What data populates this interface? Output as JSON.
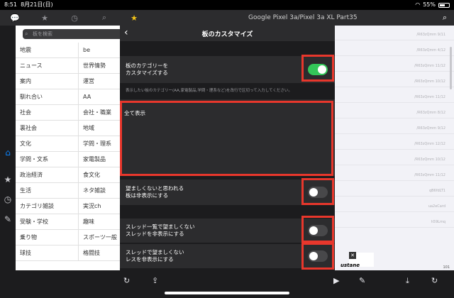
{
  "statusbar": {
    "time": "8:51",
    "date": "8月21日(日)",
    "battery": "55%"
  },
  "tabs": [
    "💬",
    "★",
    "◷",
    "⌕",
    "★"
  ],
  "thread": {
    "title": "Google Pixel 3a/Pixel 3a XL Part35",
    "search_icon": "⌕"
  },
  "search": {
    "placeholder": "板を検索"
  },
  "categories": [
    [
      "地震",
      "be"
    ],
    [
      "ニュース",
      "世界情勢"
    ],
    [
      "案内",
      "運営"
    ],
    [
      "馴れ合い",
      "AA"
    ],
    [
      "社会",
      "会社・職業"
    ],
    [
      "裏社会",
      "地域"
    ],
    [
      "文化",
      "学問・理系"
    ],
    [
      "学問・文系",
      "家電製品"
    ],
    [
      "政治経済",
      "食文化"
    ],
    [
      "生活",
      "ネタ雑談"
    ],
    [
      "カテゴリ雑談",
      "実況ch"
    ],
    [
      "受験・学校",
      "趣味"
    ],
    [
      "乗り物",
      "スポーツ一般"
    ],
    [
      "球技",
      "格闘技"
    ]
  ],
  "right_lines": [
    "/R63zQmm 9/11",
    "/R63zQmm 4/12",
    "/R63zQmm 11/12",
    "/R63zQmm 10/12",
    "/R63zQmm 11/12",
    "/R63zQmm 8/12",
    "/R63zQmm 9/12",
    "/R63zQmm 12/12",
    "/R63zQmm 10/12",
    "/R63zQmm 11/12",
    "qB6fdLT1",
    "ua2eCard",
    "h59Lmq"
  ],
  "ad": {
    "x": "✕",
    "text": "ustane"
  },
  "page_num": "101",
  "modal": {
    "title": "板のカスタマイズ",
    "back": "‹",
    "rows": {
      "customize_label": "板のカテゴリーを\nカスタマイズする",
      "description": "表示したい板のカテゴリー(AA,家電製品,学問・理系など)を改行で区切って入力してください。",
      "textarea_value": "全て表示",
      "hide_undesirable_label": "望ましくないと思われる\n板は非表示にする",
      "hide_thread_list_label": "スレッド一覧で望ましくない\nスレッドを非表示にする",
      "hide_thread_res_label": "スレッドで望ましくない\nレスを非表示にする"
    }
  },
  "toggles": {
    "customize": true,
    "hide_undesirable": false,
    "hide_thread_list": false,
    "hide_thread_res": false
  },
  "bottom_icons": [
    "↻",
    "⇪",
    "▶",
    "✎",
    "⤓",
    "↻"
  ],
  "rail_icons": [
    "⌂",
    "★",
    "◷",
    "✎",
    "⚙"
  ],
  "colors": {
    "accent_green": "#34c759",
    "highlight_red": "#e8372c",
    "tab_active": "#f5c518"
  }
}
